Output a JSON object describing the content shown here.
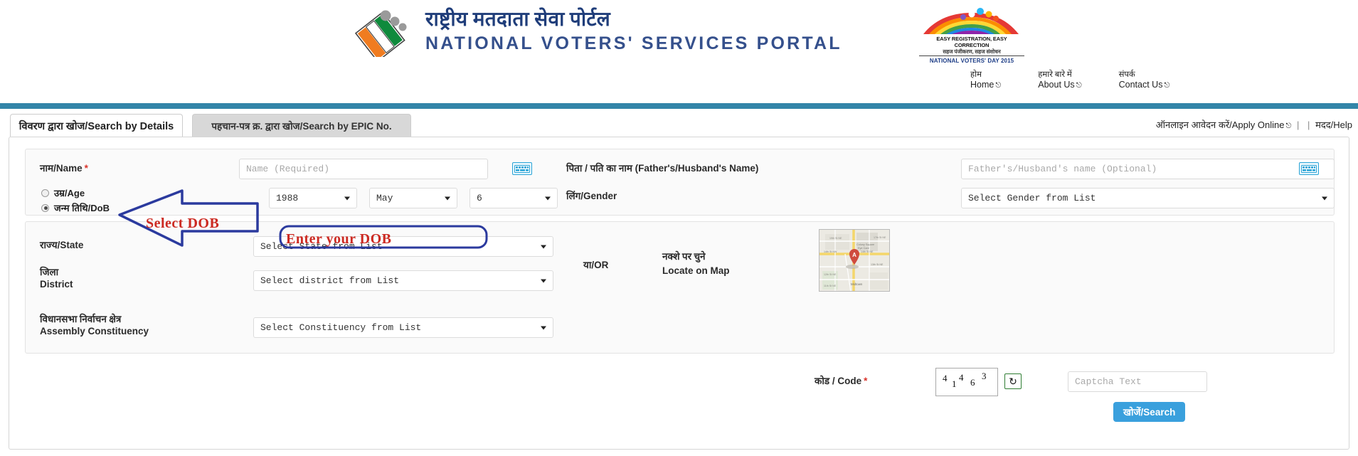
{
  "header": {
    "title_hi": "राष्ट्रीय मतदाता सेवा पोर्टल",
    "title_en": "NATIONAL VOTERS' SERVICES PORTAL",
    "eci_logo_name": "election-commission-of-india-logo",
    "nvd_logo": {
      "line1": "EASY REGISTRATION, EASY CORRECTION",
      "line2": "सहज पंजीकरण, सहज संशोधन",
      "line3": "NATIONAL VOTERS' DAY 2015"
    },
    "nav": [
      {
        "hi": "होम",
        "en": "Home"
      },
      {
        "hi": "हमारे बारे में",
        "en": "About Us"
      },
      {
        "hi": "संपर्क",
        "en": "Contact Us"
      }
    ],
    "accent_color": "#3385a8"
  },
  "tabs": {
    "active": {
      "label": "विवरण द्वारा खोज/Search by Details"
    },
    "inactive": {
      "label": "पहचान-पत्र क्र. द्वारा खोज/Search by EPIC No."
    },
    "links": {
      "apply_online": "ऑनलाइन आवेदन करें/Apply Online",
      "separator": "|",
      "help": "मदद/Help"
    }
  },
  "form": {
    "name": {
      "label_hi": "नाम",
      "label_en": "Name",
      "required_mark": "*",
      "value": "",
      "placeholder": "Name (Required)"
    },
    "father_husband": {
      "label": "पिता / पति का नाम (Father's/Husband's Name)",
      "value": "",
      "placeholder": "Father's/Husband's name (Optional)"
    },
    "age_dob": {
      "age_label_hi": "उम्र",
      "age_label_en": "Age",
      "dob_label_hi": "जन्म तिथि",
      "dob_label_en": "DoB",
      "selected": "dob",
      "year": "1988",
      "month": "May",
      "day": "6"
    },
    "gender": {
      "label_hi": "लिंग",
      "label_en": "Gender",
      "value": "Select Gender from List"
    },
    "state": {
      "label_hi": "राज्य",
      "label_en": "State",
      "value": "Select State from List"
    },
    "district": {
      "label_hi": "जिला",
      "label_en": "District",
      "value": "Select district from List"
    },
    "constituency": {
      "label_hi": "विधानसभा निर्वाचन क्षेत्र",
      "label_en": "Assembly Constituency",
      "value": "Select Constituency from List"
    },
    "or_text": "या/OR",
    "locate_map": {
      "label_hi": "नक्शे पर चुने",
      "label_en": "Locate on Map",
      "marker": "A"
    },
    "captcha": {
      "label": "कोड / Code",
      "required_mark": "*",
      "digits": [
        "4",
        "1",
        "4",
        "6",
        "3"
      ],
      "code": "41463",
      "refresh_icon": "refresh-icon",
      "input_value": "",
      "input_placeholder": "Captcha Text"
    },
    "search_button": "खोजें/Search",
    "keyboard_icon": "virtual-keyboard-icon"
  },
  "annotations": [
    {
      "id": "select-dob",
      "text": "Select DOB",
      "color": "#cc2a22",
      "shape": "left-arrow",
      "shape_color": "#2b3a9e"
    },
    {
      "id": "enter-dob",
      "text": "Enter your DOB",
      "color": "#cc2a22",
      "shape": "rounded-box",
      "shape_color": "#2b3a9e"
    }
  ]
}
